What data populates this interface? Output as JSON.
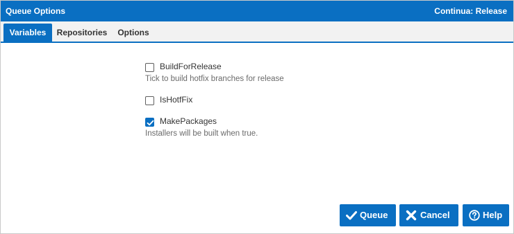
{
  "dialog": {
    "title": "Queue Options",
    "context": "Continua: Release"
  },
  "tabs": [
    {
      "label": "Variables",
      "active": true
    },
    {
      "label": "Repositories",
      "active": false
    },
    {
      "label": "Options",
      "active": false
    }
  ],
  "variables": [
    {
      "label": "BuildForRelease",
      "checked": false,
      "help": "Tick to build hotfix branches for release"
    },
    {
      "label": "IsHotfFix",
      "checked": false,
      "help": ""
    },
    {
      "label": "MakePackages",
      "checked": true,
      "help": "Installers will be built when true."
    }
  ],
  "buttons": {
    "queue": {
      "label": "Queue",
      "icon": "check-icon"
    },
    "cancel": {
      "label": "Cancel",
      "icon": "close-icon"
    },
    "help": {
      "label": "Help",
      "icon": "help-circle-icon"
    }
  },
  "colors": {
    "accent": "#0a6fc2",
    "tab_strip": "#f2f2f2",
    "help_text": "#6b6b6b"
  }
}
